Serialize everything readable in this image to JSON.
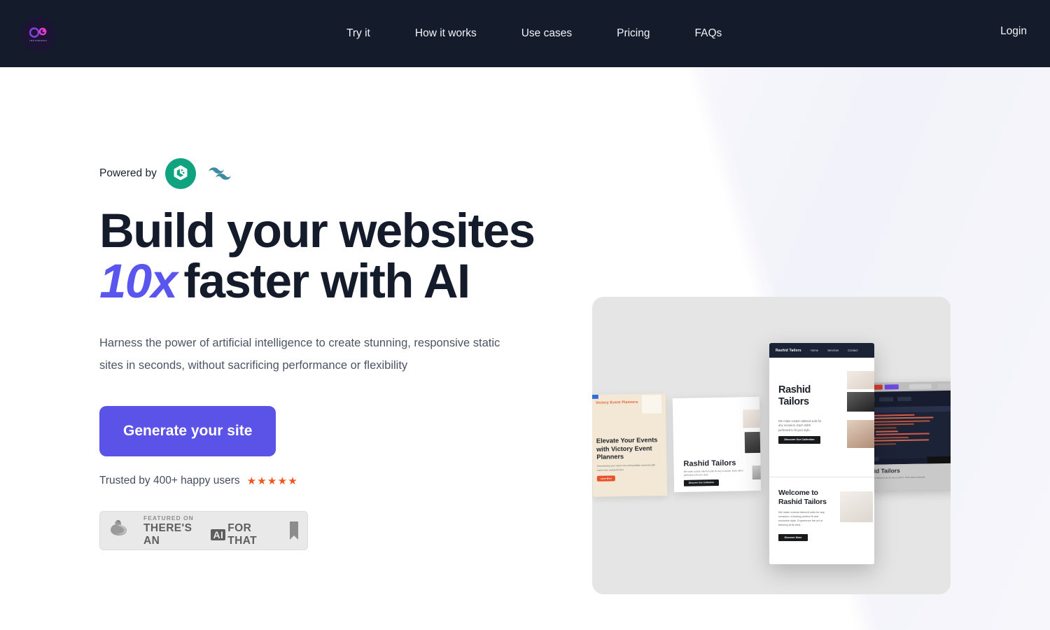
{
  "header": {
    "logo": {
      "icon": "infinity-logo-icon",
      "wordmark": "INSTAWEBAI"
    },
    "nav": [
      {
        "label": "Try it"
      },
      {
        "label": "How it works"
      },
      {
        "label": "Use cases"
      },
      {
        "label": "Pricing"
      },
      {
        "label": "FAQs"
      }
    ],
    "login_label": "Login",
    "background_color": "#141b2b"
  },
  "hero": {
    "powered_by_label": "Powered by",
    "powered_by_logos": [
      "openai-logo-icon",
      "tailwindcss-logo-icon"
    ],
    "headline_line1": "Build your websites",
    "headline_accent": "10x",
    "headline_line2_rest": "faster with AI",
    "accent_color": "#5b55ef",
    "subtitle": "Harness the power of artificial intelligence to create stunning, responsive static sites in seconds, without sacrificing performance or flexibility",
    "cta_label": "Generate your site",
    "cta_color": "#5b52e8",
    "trust_text": "Trusted by 400+ happy users",
    "stars": "★★★★★",
    "star_color": "#f2561f"
  },
  "featured_badge": {
    "small_label": "FEATURED ON",
    "big_label_before": "THERE'S AN",
    "chip_label": "AI",
    "big_label_after": "FOR THAT",
    "arm_icon": "flexed-arm-icon",
    "bookmark_icon": "bookmark-icon"
  },
  "showcase": {
    "background_color": "#e5e5e5",
    "victory_card": {
      "brand": "Victory Event Planners",
      "headline": "Elevate Your Events with Victory Event Planners",
      "body": "Transforming your vision into unforgettable moments with expert care and perfection",
      "button": "Learn More"
    },
    "white_card": {
      "headline": "Rashid Tailors",
      "body": "We make custom tailored suits for any occasion. Each stitch perfected to fit your style.",
      "button": "Discover Our Collection"
    },
    "phone_card": {
      "brand": "Rashid Tailors",
      "nav": [
        "Home",
        "Services",
        "Contact"
      ],
      "hero_headline": "Rashid Tailors",
      "hero_body": "We make custom tailored suits for any occasion. Each stitch perfected to fit your style.",
      "hero_button": "Discover Our Collection",
      "welcome_headline": "Welcome to Rashid Tailors",
      "welcome_body": "We make custom tailored suits for any occasion, ensuring perfect fit and exclusive style. Experience the art of tailoring at its best.",
      "welcome_button": "Discover More"
    },
    "code_card": {
      "headline": "Rashid Tailors",
      "body": "We make custom tailored suits for any occasion. Each stitch perfected."
    }
  }
}
